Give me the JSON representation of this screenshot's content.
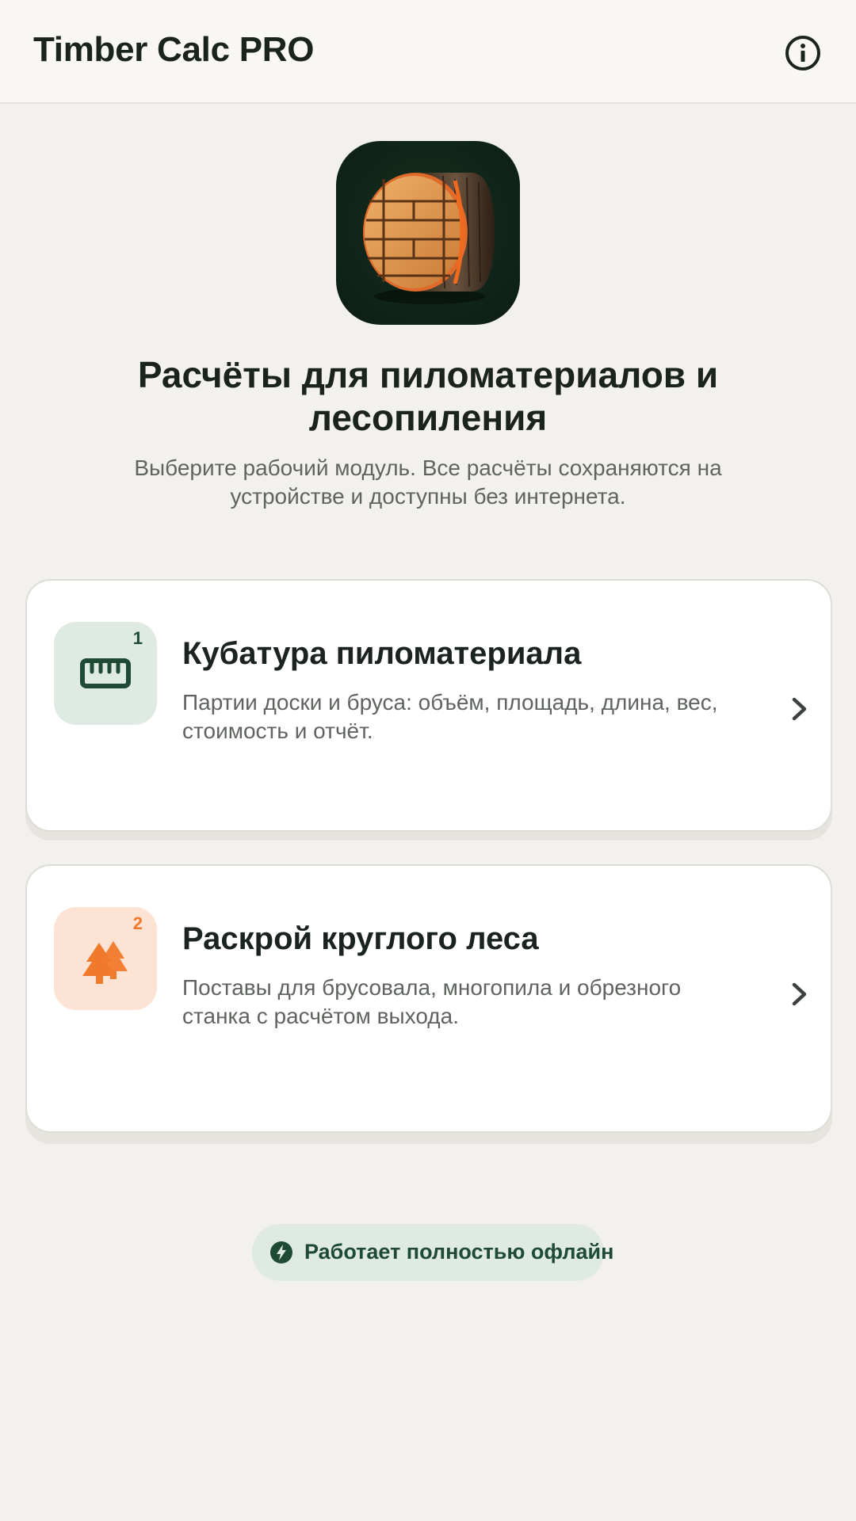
{
  "app": {
    "title": "Timber Calc PRO",
    "info_icon": "info-circle-icon"
  },
  "hero": {
    "logo": "log-with-boards-logo",
    "title": "Расчёты для пиломатериалов и лесопиления",
    "subtitle": "Выберите рабочий модуль. Все расчёты сохраняются на устройстве и доступны без интернета."
  },
  "modules": [
    {
      "badge": "1",
      "icon": "ruler-icon",
      "title": "Кубатура пиломатериала",
      "description": "Партии доски и бруса: объём, площадь, длина, вес, стоимость и отчёт.",
      "accent": "#1f4a35"
    },
    {
      "badge": "2",
      "icon": "trees-icon",
      "title": "Раскрой круглого леса",
      "description": "Поставы для брусовала, многопила и обрезного станка с расчётом выхода.",
      "accent": "#f07a2c"
    }
  ],
  "offline_badge": {
    "icon": "bolt-icon",
    "label": "Работает полностью офлайн"
  },
  "colors": {
    "background": "#f2f1ed",
    "primary": "#1f4a35",
    "accent_orange": "#f07a2c",
    "green_tint": "#dfeae2",
    "orange_tint": "#fde3d3"
  }
}
